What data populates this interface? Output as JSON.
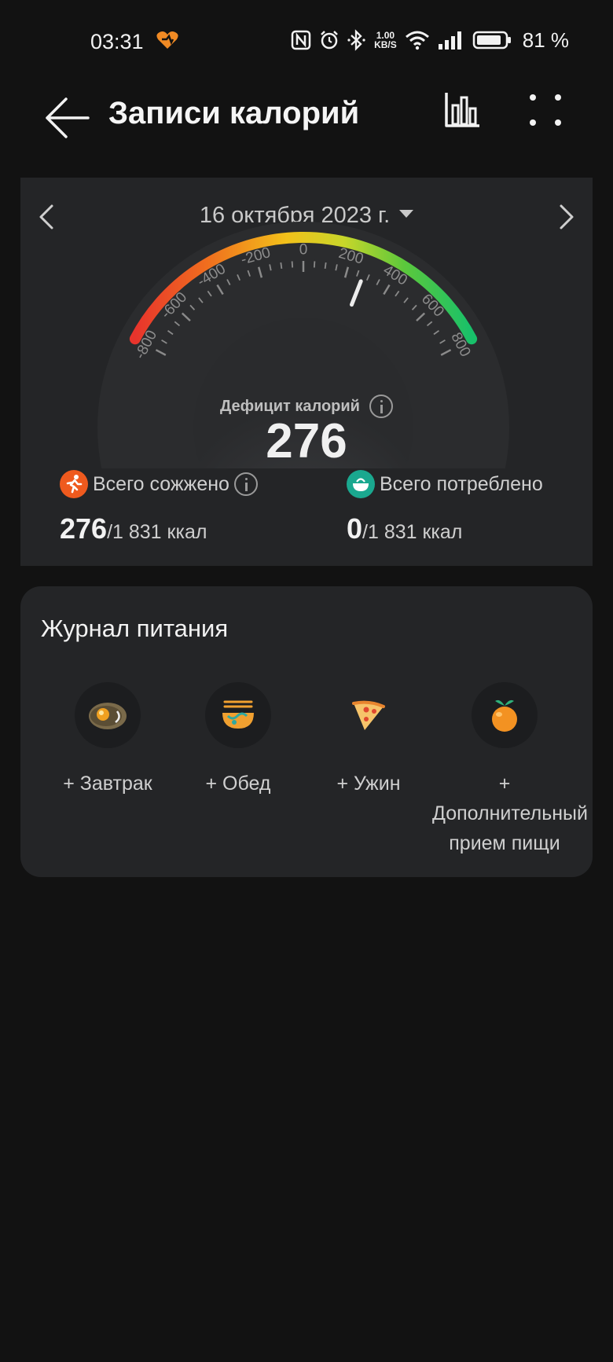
{
  "status_bar": {
    "time": "03:31",
    "net_speed_value": "1.00",
    "net_speed_unit": "KB/S",
    "battery": "81 %"
  },
  "header": {
    "title": "Записи калорий"
  },
  "summary": {
    "date": "16 октября 2023 г.",
    "gauge": {
      "ticks": [
        "-800",
        "-600",
        "-400",
        "-200",
        "0",
        "200",
        "400",
        "600",
        "800"
      ],
      "min": -900,
      "max": 900,
      "value": 276,
      "label": "Дефицит калорий",
      "value_text": "276"
    },
    "burned": {
      "label": "Всего сожжено",
      "value": "276",
      "goal": "/1 831 ккал"
    },
    "consumed": {
      "label": "Всего потреблено",
      "value": "0",
      "goal": "/1 831 ккал"
    },
    "colors": {
      "burned_badge": "#ef5a1e",
      "consumed_badge": "#1aa88f"
    }
  },
  "journal": {
    "title": "Журнал питания",
    "meals": [
      {
        "label": "+ Завтрак",
        "icon": "fried-egg-icon"
      },
      {
        "label": "+ Обед",
        "icon": "noodle-bowl-icon"
      },
      {
        "label": "+ Ужин",
        "icon": "pizza-slice-icon"
      },
      {
        "label": "+ Дополнительный прием пищи",
        "icon": "orange-fruit-icon"
      }
    ]
  }
}
